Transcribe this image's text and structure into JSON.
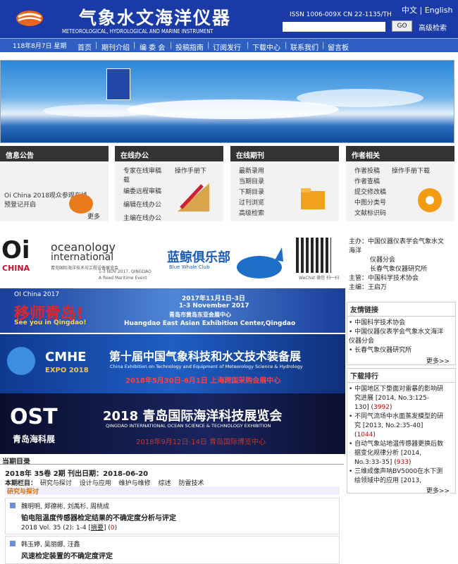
{
  "header": {
    "title_cn": "气象水文海洋仪器",
    "title_en": "METEOROLOGICAL, HYDROLOGICAL AND MARINE INSTRUMENT",
    "issn": "ISSN 1006-009X   CN 22-1135/TH",
    "lang_cn": "中文",
    "lang_sep": "|",
    "lang_en": "English",
    "search_placeholder": "",
    "go": "GO",
    "advanced": "高级检索"
  },
  "nav": {
    "date": "118年8月7日  星期",
    "items": [
      "首页",
      "期刊介绍",
      "编 委 会",
      "投稿指南",
      "订阅发行",
      "下载中心",
      "联系我们",
      "留言板"
    ],
    "sep": "|"
  },
  "panels": [
    {
      "title": "信息公告",
      "lines": [
        "Oi China 2018观众参观在线",
        "预登记开启"
      ],
      "more": "更多"
    },
    {
      "title": "在线办公",
      "lines": [
        "专家在线审稿",
        "操作手册下",
        "载",
        "编委远程审稿",
        "编辑在线办公",
        "主编在线办公"
      ]
    },
    {
      "title": "在线期刊",
      "lines": [
        "最新录用",
        "当期目录",
        "下期目录",
        "过刊浏览",
        "高级检索"
      ]
    },
    {
      "title": "作者相关",
      "lines": [
        "作者投稿",
        "操作手册下载",
        "作者查稿",
        "提交修改稿",
        "中图分类号",
        "文献标识码"
      ]
    }
  ],
  "ads": {
    "oi": {
      "oi": "Oi",
      "china": "CHINA",
      "oceanology": "oceanology",
      "international": "international",
      "sub": "青岛国际海洋技术与工程设备展览会",
      "dates": "1-3 NOV 2017, QINGDAO",
      "event": "A Reed Maritime Event",
      "club": "蓝鲸俱乐部",
      "club_en": "Blue Whale Club",
      "wechat": "WeChat 微信 扫一扫"
    },
    "oi2017": {
      "title": "OI China 2017",
      "cn": "移师青岛!",
      "en": "See you in Qingdao!",
      "d1": "2017年11月1日-3日",
      "d2": "1-3 November 2017",
      "d3": "青岛市黄岛东亚会展中心",
      "d4": "Huangdao East Asian Exhibition Center,Qingdao"
    },
    "cmhe": {
      "logo": "CMHE",
      "expo": "EXPO 2018",
      "title": "第十届中国气象科技和水文技术装备展",
      "en": "China Exhibition on Technology and Equipment of Meteorology Science & Hydrology",
      "date": "2018年5月30日-6月1日  上海跨国采购会展中心"
    },
    "ost": {
      "logo": "OST",
      "cn": "青岛海科展",
      "title": "2018 青岛国际海洋科技展览会",
      "en": "QINGDAO INTERNATIONAL OCEAN SCIENCE & TECHNOLOGY EXHIBITION",
      "date": "2018年9月12日-14日  青岛国际博览中心"
    }
  },
  "info": {
    "lines": [
      "主办：中国仪器仪表学会气象水文",
      "海洋",
      "仪器分会",
      "长春气象仪器研究所",
      "主管：中国科学技术协会",
      "主编：王启万"
    ]
  },
  "links": {
    "title": "友情链接",
    "items": [
      "中国科学技术协会",
      "中国仪器仪表学会气象水文海洋",
      "仪器分会",
      "长春气象仪器研究所"
    ],
    "more": "更多>>"
  },
  "downloads": {
    "title": "下载排行",
    "items": [
      {
        "l1": "中国地区下垫面对雷暴的影响研",
        "l2": "究进展 [2014, No.3:125-",
        "l3": "130] (",
        "count": "3992",
        ")": ")"
      },
      {
        "l1": "不同气流场中水面蒸发模型的研",
        "l2": "究 [2013, No.2:35-40]",
        "l3": "(",
        "count": "1044",
        ")": ")"
      },
      {
        "l1": "自动气象站地温传感器更换后数",
        "l2": "据变化规律分析 [2014,",
        "l3": "No.3:33-35] (",
        "count": "933",
        ")": ")"
      },
      {
        "l1": "三维成像声呐BV5000在水下测",
        "l2": "绘领域中的应用 [2013,",
        "l3": "",
        "count": "",
        ")": ""
      }
    ],
    "more": "更多>>"
  },
  "current": {
    "title": "当期目录",
    "issue": "2018年  35卷  2期    刊出日期：2018-06-20",
    "cols_label": "本期栏目：",
    "cols": [
      "研究与探讨",
      "设计与应用",
      "维护与维修",
      "综述",
      "防雷技术"
    ],
    "section": "研究与探讨",
    "articles": [
      {
        "authors": "魏明明, 郑德彬, 刘禹杉, 周桃成",
        "title": "铂电阻温度传感器检定结果的不确定度分析与评定",
        "ref": "2018 Vol. 35 (2): 1-4 [",
        "abs": "摘要",
        "tail": "] (",
        "count": "0",
        "end": ")"
      },
      {
        "authors": "韩玉婷, 吴丽娜, 汪鑫",
        "title": "风速检定装置的不确定度评定"
      }
    ]
  }
}
